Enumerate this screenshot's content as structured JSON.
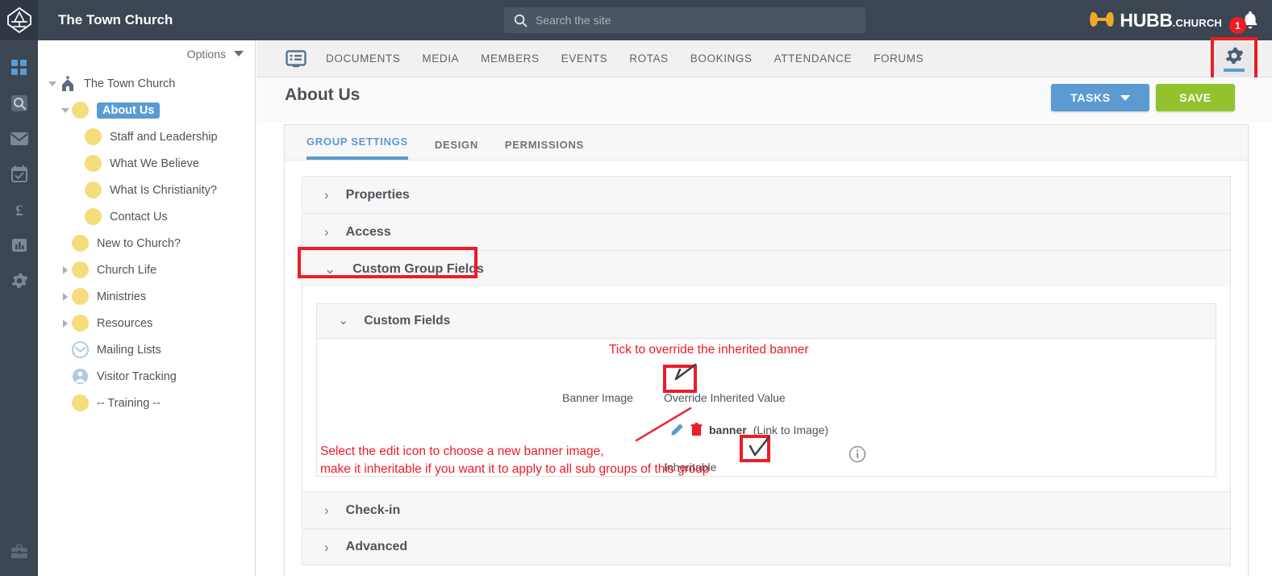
{
  "header": {
    "site_title": "The Town Church",
    "search": {
      "placeholder": "Search the site",
      "value": "",
      "icon": "search-icon"
    },
    "brand": {
      "name": "HUBB",
      "suffix": ".CHURCH",
      "mark_color": "#f1a82a"
    },
    "notifications": {
      "count": "1",
      "icon": "bell-icon",
      "badge_color": "#ed1c24"
    },
    "logo_icon": "church-diamond-logo-icon"
  },
  "rail": {
    "items": [
      {
        "name": "dashboard-icon",
        "label": "Dashboard",
        "active": true
      },
      {
        "name": "search-icon",
        "label": "Search",
        "active": false
      },
      {
        "name": "mail-icon",
        "label": "Mail",
        "active": false
      },
      {
        "name": "calendar-check-icon",
        "label": "Calendar",
        "active": false
      },
      {
        "name": "pound-icon",
        "label": "Giving",
        "active": false
      },
      {
        "name": "bar-chart-icon",
        "label": "Reports",
        "active": false
      },
      {
        "name": "gear-icon",
        "label": "Settings",
        "active": false
      }
    ],
    "bottom": {
      "name": "briefcase-icon",
      "label": "Admin"
    }
  },
  "tree": {
    "options_label": "Options",
    "options_icon": "chevron-down-icon",
    "nodes": [
      {
        "label": "The Town Church",
        "indent": 0,
        "twisty": "open",
        "icon": "church-icon",
        "selected": false
      },
      {
        "label": "About Us",
        "indent": 1,
        "twisty": "open",
        "icon": "group-dot",
        "selected": true
      },
      {
        "label": "Staff and Leadership",
        "indent": 2,
        "twisty": "none",
        "icon": "group-dot",
        "selected": false
      },
      {
        "label": "What We Believe",
        "indent": 2,
        "twisty": "none",
        "icon": "group-dot",
        "selected": false
      },
      {
        "label": "What Is Christianity?",
        "indent": 2,
        "twisty": "none",
        "icon": "group-dot",
        "selected": false
      },
      {
        "label": "Contact Us",
        "indent": 2,
        "twisty": "none",
        "icon": "group-dot",
        "selected": false
      },
      {
        "label": "New to Church?",
        "indent": 1,
        "twisty": "none",
        "icon": "group-dot",
        "selected": false
      },
      {
        "label": "Church Life",
        "indent": 1,
        "twisty": "closed",
        "icon": "group-dot",
        "selected": false
      },
      {
        "label": "Ministries",
        "indent": 1,
        "twisty": "closed",
        "icon": "group-dot",
        "selected": false
      },
      {
        "label": "Resources",
        "indent": 1,
        "twisty": "closed",
        "icon": "group-dot",
        "selected": false
      },
      {
        "label": "Mailing Lists",
        "indent": 1,
        "twisty": "none",
        "icon": "mailing-list-icon",
        "selected": false
      },
      {
        "label": "Visitor Tracking",
        "indent": 1,
        "twisty": "none",
        "icon": "visitor-icon",
        "selected": false
      },
      {
        "label": "-- Training --",
        "indent": 1,
        "twisty": "none",
        "icon": "group-dot",
        "selected": false
      }
    ]
  },
  "nav": {
    "list_icon": "list-view-icon",
    "items": [
      "DOCUMENTS",
      "MEDIA",
      "MEMBERS",
      "EVENTS",
      "ROTAS",
      "BOOKINGS",
      "ATTENDANCE",
      "FORUMS"
    ],
    "settings_icon": "gear-icon"
  },
  "page": {
    "title": "About Us",
    "tasks_button": "TASKS",
    "tasks_caret_icon": "chevron-down-icon",
    "save_button": "SAVE",
    "tasks_color": "#5b9bd1",
    "save_color": "#92c32e"
  },
  "card_tabs": [
    {
      "label": "GROUP SETTINGS",
      "active": true
    },
    {
      "label": "DESIGN",
      "active": false
    },
    {
      "label": "PERMISSIONS",
      "active": false
    }
  ],
  "accordions": [
    {
      "label": "Properties",
      "state": "collapsed",
      "icon": "chevron-right-icon"
    },
    {
      "label": "Access",
      "state": "collapsed",
      "icon": "chevron-right-icon"
    },
    {
      "label": "Custom Group Fields",
      "state": "expanded",
      "icon": "chevron-down-icon",
      "highlighted": true
    },
    {
      "label": "Check-in",
      "state": "collapsed",
      "icon": "chevron-right-icon"
    },
    {
      "label": "Advanced",
      "state": "collapsed",
      "icon": "chevron-right-icon"
    }
  ],
  "custom_fields": {
    "panel_title": "Custom Fields",
    "panel_icon": "chevron-down-icon",
    "banner_label": "Banner Image",
    "override_label": "Override Inherited Value",
    "override_checked": true,
    "field_name": "banner",
    "field_type": "(Link to Image)",
    "edit_icon": "pencil-icon",
    "delete_icon": "trash-icon",
    "info_icon": "info-circle-icon",
    "inheritable_label": "Inheritable",
    "inheritable_checked": true
  },
  "annotations": {
    "color": "#ee1c25",
    "tick_note": "Tick to override the inherited banner",
    "select_note_line1": "Select  the edit icon to choose a new banner image,",
    "select_note_line2": "make it inheritable if you want it to apply to all sub groups of this group"
  }
}
